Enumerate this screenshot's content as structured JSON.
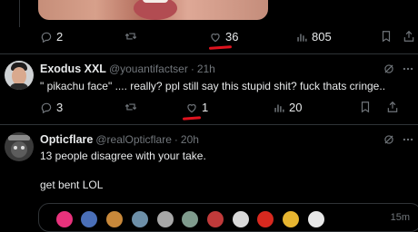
{
  "tweet1": {
    "stats": {
      "replies": "2",
      "likes": "36",
      "views": "805"
    }
  },
  "tweet2": {
    "name": "Exodus XXL",
    "handle": "@youantifactser",
    "sep": "·",
    "time": "21h",
    "text": "\" pikachu face\" .... really?  ppl still say this stupid shit?  fuck thats cringe..",
    "stats": {
      "replies": "3",
      "likes": "1",
      "views": "20"
    }
  },
  "tweet3": {
    "name": "Opticflare",
    "handle": "@realOpticflare",
    "sep": "·",
    "time": "20h",
    "line1": "13 people disagree with your take.",
    "line2": "get bent LOL",
    "quote_time": "15m"
  },
  "colors": {
    "background": "#000000",
    "muted": "#71767b",
    "text": "#e7e9ea",
    "annotation": "#e0131f"
  },
  "icons": [
    "reply-icon",
    "retweet-icon",
    "like-icon",
    "views-icon",
    "bookmark-icon",
    "share-icon",
    "grok-icon",
    "more-icon"
  ]
}
